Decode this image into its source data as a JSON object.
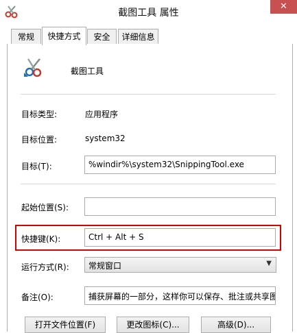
{
  "window": {
    "title": "截图工具 属性",
    "close_glyph": "✕",
    "accent_color": "#c75050",
    "highlight_color": "#d40000"
  },
  "tabs": [
    {
      "label": "常规",
      "active": false
    },
    {
      "label": "快捷方式",
      "active": true
    },
    {
      "label": "安全",
      "active": false
    },
    {
      "label": "详细信息",
      "active": false
    }
  ],
  "app": {
    "name": "截图工具",
    "icon": "scissors-icon"
  },
  "fields": {
    "target_type": {
      "label": "目标类型:",
      "value": "应用程序"
    },
    "target_location": {
      "label": "目标位置:",
      "value": "system32"
    },
    "target": {
      "label": "目标(T):",
      "value": "%windir%\\system32\\SnippingTool.exe"
    },
    "start_in": {
      "label": "起始位置(S):",
      "value": ""
    },
    "shortcut_key": {
      "label": "快捷键(K):",
      "value": "Ctrl + Alt + S"
    },
    "run": {
      "label": "运行方式(R):",
      "value": "常规窗口"
    },
    "comment": {
      "label": "备注(O):",
      "value": "捕获屏幕的一部分，这样你可以保存、批注或共享图"
    }
  },
  "buttons": {
    "open_location": "打开文件位置(F)",
    "change_icon": "更改图标(C)...",
    "advanced": "高级(D)..."
  }
}
